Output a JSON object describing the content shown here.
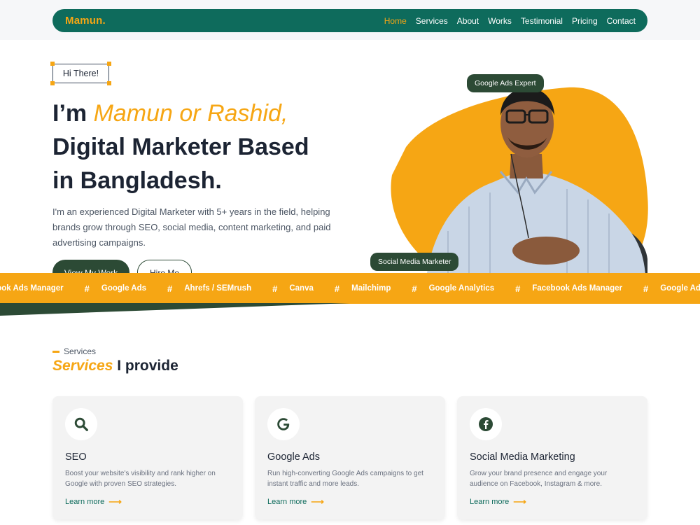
{
  "nav": {
    "logo": "Mamun.",
    "items": [
      "Home",
      "Services",
      "About",
      "Works",
      "Testimonial",
      "Pricing",
      "Contact"
    ],
    "active": "Home"
  },
  "hero": {
    "greeting": "Hi There!",
    "headline_prefix": "I’m ",
    "headline_name": "Mamun or Rashid,",
    "headline_line2": "Digital Marketer Based",
    "headline_line3": "in Bangladesh.",
    "description": "I'm an experienced Digital Marketer with 5+ years in the field, helping brands grow through SEO, social media, content marketing, and paid advertising campaigns.",
    "primary_button": "View My Work",
    "secondary_button": "Hire Me",
    "badge_top": "Google Ads Expert",
    "badge_bottom": "Social Media Marketer"
  },
  "marquee": {
    "items": [
      "Facebook Ads Manager",
      "Google Ads",
      "Ahrefs / SEMrush",
      "Canva",
      "Mailchimp",
      "Google Analytics",
      "Facebook Ads Manager",
      "Google Ads"
    ]
  },
  "services": {
    "eyebrow": "Services",
    "title_accent": "Services",
    "title_rest": " I provide",
    "cards": [
      {
        "icon": "search-icon",
        "title": "SEO",
        "description": "Boost your website's visibility and rank higher on Google with proven SEO strategies.",
        "link": "Learn more"
      },
      {
        "icon": "google-icon",
        "title": "Google Ads",
        "description": "Run high-converting Google Ads campaigns to get instant traffic and more leads.",
        "link": "Learn more"
      },
      {
        "icon": "facebook-icon",
        "title": "Social Media Marketing",
        "description": "Grow your brand presence and engage your audience on Facebook, Instagram & more.",
        "link": "Learn more"
      }
    ]
  },
  "colors": {
    "primary": "#0e6b5c",
    "accent": "#f6a614",
    "dark_green": "#2c4a35",
    "text": "#1c2433"
  }
}
